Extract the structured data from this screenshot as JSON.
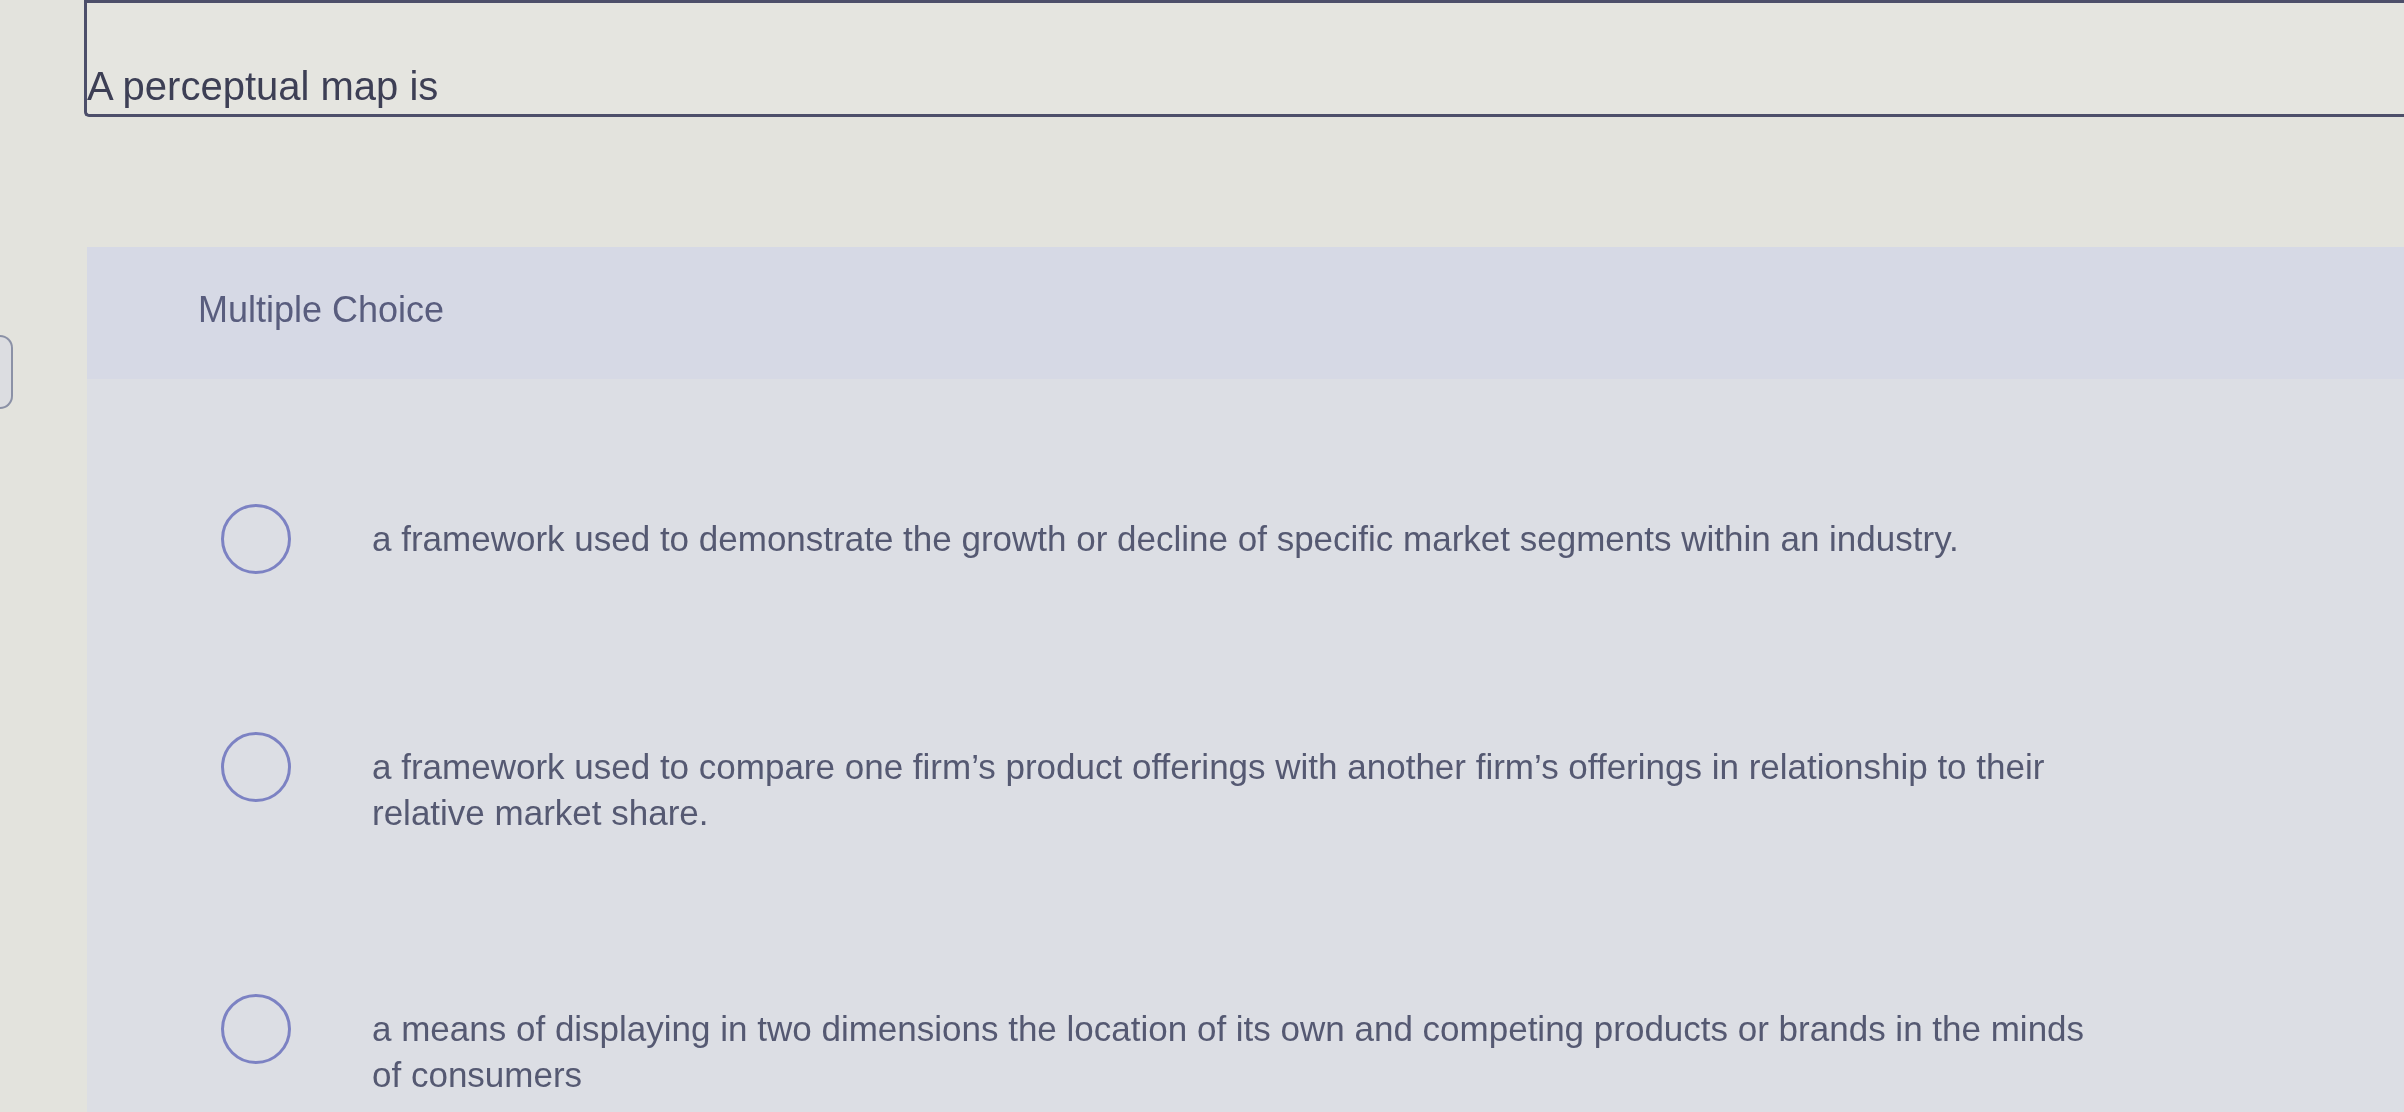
{
  "question": {
    "text": "A perceptual map is"
  },
  "answer_panel": {
    "heading": "Multiple Choice",
    "options": [
      {
        "text": "a framework used to demonstrate the growth or decline of specific market segments within an industry.",
        "selected": false
      },
      {
        "text": "a framework used to compare one firm’s product offerings with another firm’s offerings in relationship to their relative market share.",
        "selected": false
      },
      {
        "text": "a means of displaying in two dimensions the location of its own and competing products or brands in the minds of consumers",
        "selected": false
      }
    ]
  }
}
